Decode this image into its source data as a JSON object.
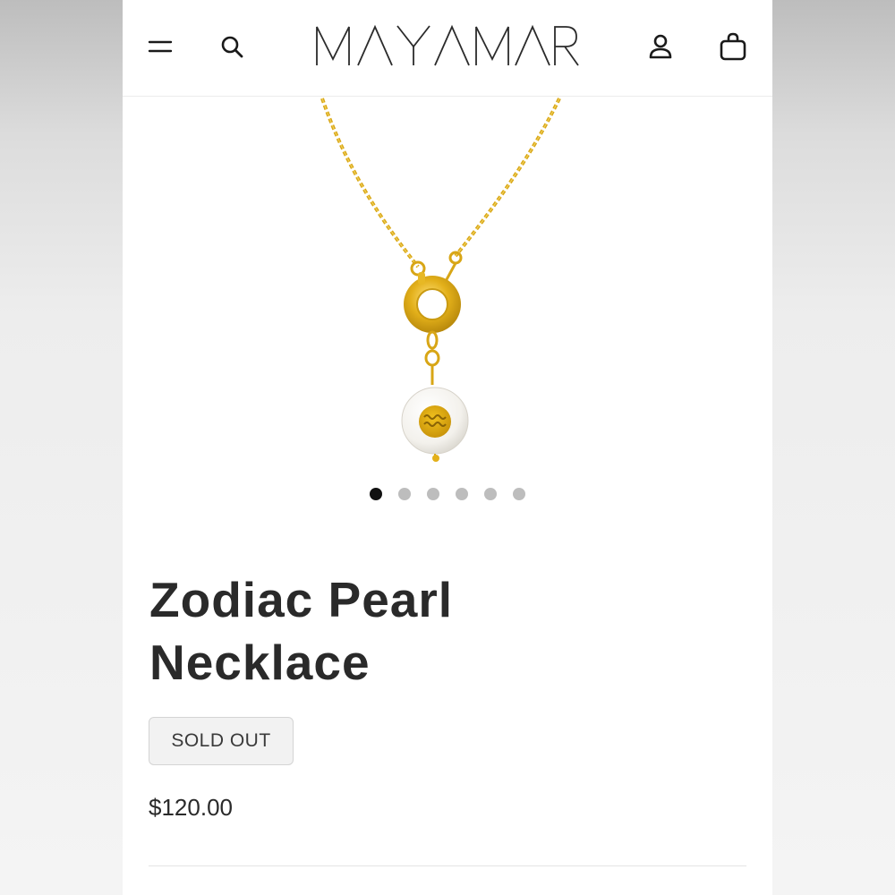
{
  "header": {
    "logo_text": "MAYAMAR",
    "icons": {
      "menu": "menu-icon",
      "search": "search-icon",
      "account": "user-icon",
      "cart": "shopping-bag-icon"
    }
  },
  "product": {
    "image_alt": "Zodiac Pearl Necklace",
    "title": "Zodiac Pearl Necklace",
    "badge": "SOLD OUT",
    "price": "$120.00"
  },
  "carousel": {
    "total": 6,
    "active_index": 0
  },
  "colors": {
    "gold": "#e0b21c",
    "text": "#2a2a2a",
    "dot_active": "#111111",
    "dot_inactive": "#bdbdbd"
  }
}
